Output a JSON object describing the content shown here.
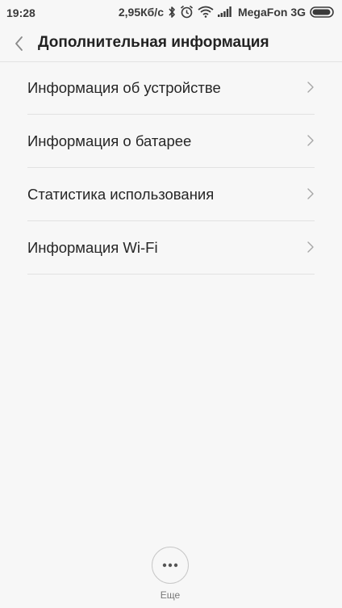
{
  "status_bar": {
    "time": "19:28",
    "speed": "2,95Кб/с",
    "carrier": "MegaFon 3G",
    "icons": [
      "bluetooth-icon",
      "alarm-icon",
      "wifi-icon",
      "signal-icon",
      "battery-icon"
    ]
  },
  "header": {
    "title": "Дополнительная информация",
    "back_icon": "chevron-left-icon"
  },
  "list": {
    "items": [
      {
        "label": "Информация об устройстве"
      },
      {
        "label": "Информация о батарее"
      },
      {
        "label": "Статистика использования"
      },
      {
        "label": "Информация Wi-Fi"
      }
    ]
  },
  "footer": {
    "more_label": "Еще",
    "more_icon": "more-dots-icon"
  }
}
